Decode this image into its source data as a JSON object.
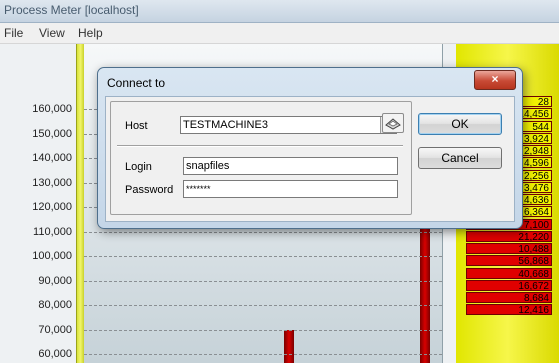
{
  "app": {
    "title": "Process Meter [localhost]",
    "menu": [
      "File",
      "View",
      "Help"
    ]
  },
  "chart_data": {
    "type": "bar",
    "ylim": [
      60000,
      165000
    ],
    "y_ticks": [
      "160,000",
      "150,000",
      "140,000",
      "130,000",
      "120,000",
      "110,000",
      "100,000",
      "90,000",
      "80,000",
      "70,000",
      "60,000"
    ],
    "bars": [
      {
        "value": 70000
      },
      {
        "value": 112000
      }
    ],
    "right_values": [
      "28",
      "14,456",
      "544",
      "3,924",
      "2,948",
      "4,596",
      "2,256",
      "3,476",
      "4,636",
      "6,364",
      "7,100",
      "21,220",
      "10,488",
      "56,868",
      "40,668",
      "16,672",
      "8,684",
      "12,416"
    ]
  },
  "dialog": {
    "title": "Connect to",
    "close_icon": "×",
    "host_label": "Host",
    "host_value": "TESTMACHINE3",
    "login_label": "Login",
    "login_value": "snapfiles",
    "password_label": "Password",
    "password_value": "*******",
    "ok_label": "OK",
    "cancel_label": "Cancel"
  }
}
